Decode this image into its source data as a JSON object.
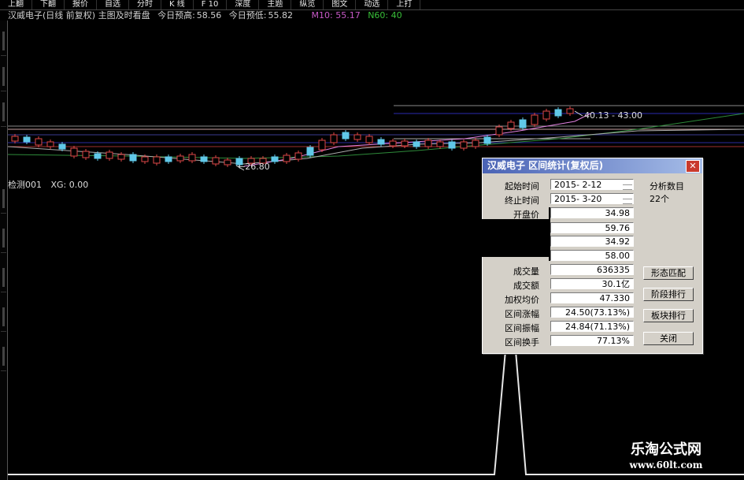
{
  "menu": [
    "上翻",
    "下翻",
    "报价",
    "自选",
    "分时",
    "K 线",
    "F 10",
    "深度",
    "主题",
    "纵览",
    "图文",
    "动选",
    "上打"
  ],
  "info": {
    "stock_title": "汉威电子(日线 前复权) 主图及时看盘",
    "today_high_label": "今日预高:",
    "today_high": "58.56",
    "today_low_label": "今日预低:",
    "today_low": "55.82",
    "m10": "M10: 55.17",
    "n60": "N60: 40",
    "colors": {
      "title": "#d0d0d0",
      "m10": "#c85ac8",
      "n60": "#39c039"
    }
  },
  "chart": {
    "label_high": "40.13 - 43.00",
    "label_low": "←26.80"
  },
  "indicator": {
    "name": "检测001",
    "xg": "XG: 0.00"
  },
  "dialog": {
    "title": "汉威电子  区间统计(复权后)",
    "start_label": "起始时间",
    "start_value": "2015- 2-12",
    "end_label": "终止时间",
    "end_value": "2015- 3-20",
    "analysis_label": "分析数目",
    "analysis_value": "22个",
    "open_label": "开盘价",
    "open_value": "34.98",
    "high_value": "59.76",
    "low_value": "34.92",
    "close_value": "58.00",
    "volume_label": "成交量",
    "volume_value": "636335",
    "amount_label": "成交额",
    "amount_value": "30.1亿",
    "vwap_label": "加权均价",
    "vwap_value": "47.330",
    "rise_label": "区间涨幅",
    "rise_value": "24.50(73.13%)",
    "swing_label": "区间振幅",
    "swing_value": "24.84(71.13%)",
    "turnover_label": "区间换手",
    "turnover_value": "77.13%",
    "btn_pattern": "形态匹配",
    "btn_stage": "阶段排行",
    "btn_sector": "板块排行",
    "btn_close": "关闭",
    "close_glyph": "✕"
  },
  "watermark": {
    "line1": "乐淘公式网",
    "line2": "www.60lt.com"
  }
}
